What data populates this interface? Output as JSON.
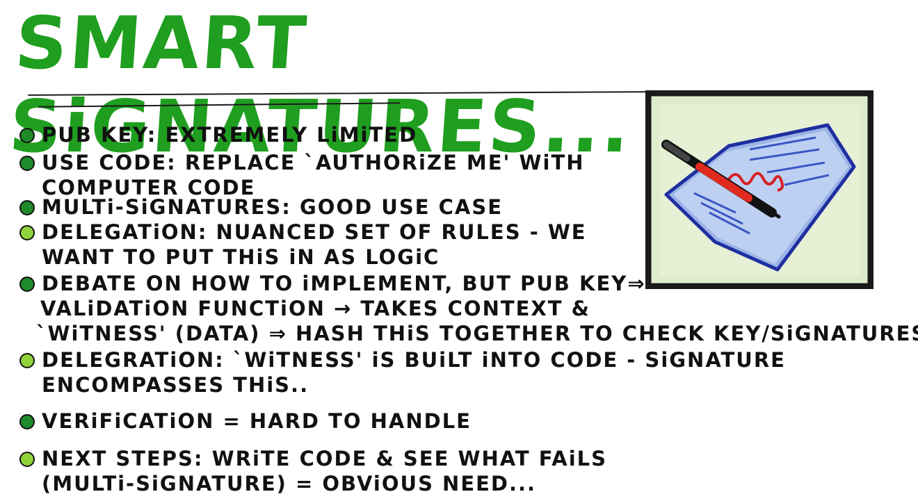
{
  "title": "SMART SiGNATURES...",
  "colors": {
    "title": "#1f9e1f",
    "ink": "#111111",
    "dot_dark": "#1e8a2a",
    "dot_light": "#8fd23a",
    "frame": "#1a1a1a",
    "panel": "#dfeccb",
    "paper": "#b8cdf0",
    "paper_edge": "#1f2fa0"
  },
  "bullets": [
    {
      "dot": "dark",
      "lines": [
        "PUB KEY: EXTREMELY LiMiTED"
      ]
    },
    {
      "dot": "dark",
      "lines": [
        "USE CODE: REPLACE `AUTHORiZE ME' WiTH",
        "COMPUTER CODE"
      ]
    },
    {
      "dot": "dark",
      "lines": [
        "MULTi-SiGNATURES: GOOD USE CASE"
      ]
    },
    {
      "dot": "light",
      "lines": [
        "DELEGATiON: NUANCED SET OF RULES - WE",
        "WANT TO PUT THiS iN AS LOGiC"
      ]
    },
    {
      "dot": "dark",
      "lines": [
        "DEBATE ON HOW TO iMPLEMENT, BUT PUB KEY⇒",
        "VALiDATiON FUNCTiON → TAKES CONTEXT &",
        "`WiTNESS' (DATA) ⇒ HASH THiS TOGETHER TO  CHECK KEY/SiGNATURES"
      ]
    },
    {
      "dot": "light",
      "lines": [
        "DELEGRATiON: `WiTNESS' iS BUiLT iNTO CODE - SiGNATURE",
        "ENCOMPASSES THiS.."
      ]
    },
    {
      "dot": "dark",
      "lines": [
        "VERiFiCATiON = HARD TO HANDLE"
      ]
    },
    {
      "dot": "light",
      "lines": [
        "NEXT STEPS: WRiTE CODE & SEE WHAT FAiLS",
        "(MULTi-SiGNATURE) = OBViOUS NEED..."
      ]
    }
  ],
  "illustration": {
    "icon": "signing-document-icon"
  }
}
